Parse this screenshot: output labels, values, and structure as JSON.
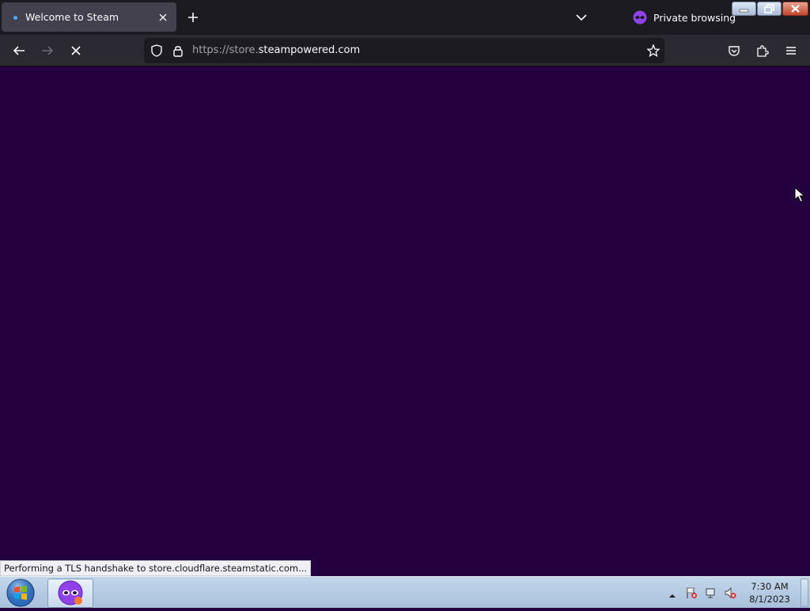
{
  "browser": {
    "tab": {
      "title": "Welcome to Steam",
      "loading_dot_color": "#4aa8ff"
    },
    "private_label": "Private browsing",
    "url": {
      "prefix": "https://store.",
      "host": "steampowered.com"
    },
    "content_bg": "#25003e"
  },
  "status_bar": {
    "text": "Performing a TLS handshake to store.cloudflare.steamstatic.com..."
  },
  "taskbar": {
    "clock_time": "7:30 AM",
    "clock_date": "8/1/2023"
  },
  "icons": {
    "tab_close": "close-icon",
    "new_tab": "plus-icon",
    "list_tabs": "chevron-down-icon",
    "private": "private-mask-icon",
    "back": "back-arrow-icon",
    "forward": "forward-arrow-icon",
    "stop": "stop-loading-icon",
    "tracking": "shield-icon",
    "lock": "lock-icon",
    "bookmark": "star-icon",
    "pocket": "pocket-icon",
    "extensions": "puzzle-icon",
    "menu": "hamburger-menu-icon"
  }
}
